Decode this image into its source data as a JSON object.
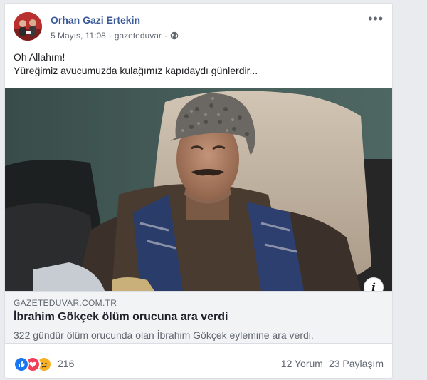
{
  "post": {
    "author": "Orhan Gazi Ertekin",
    "date": "5 Mayıs, 11:08",
    "separator": "·",
    "source": "gazeteduvar",
    "privacy_icon": "globe-icon",
    "more_icon": "more-options-icon",
    "text_lines": [
      "Oh Allahım!",
      "Yüreğimiz avucumuzda kulağımız kapıdaydı günlerdir..."
    ]
  },
  "link_preview": {
    "domain": "GAZETEDUVAR.COM.TR",
    "title": "İbrahim Gökçek ölüm orucuna ara verdi",
    "description": "322 gündür ölüm orucunda olan İbrahim Gökçek eylemine ara verdi.",
    "info_label": "i"
  },
  "footer": {
    "reaction_icons": [
      "like-icon",
      "love-icon",
      "sad-icon"
    ],
    "reaction_count": "216",
    "comments": "12 Yorum",
    "shares": "23 Paylaşım"
  },
  "colors": {
    "author": "#385898",
    "like": "#1877f2",
    "love": "#f33e58",
    "sad": "#f7b125"
  }
}
